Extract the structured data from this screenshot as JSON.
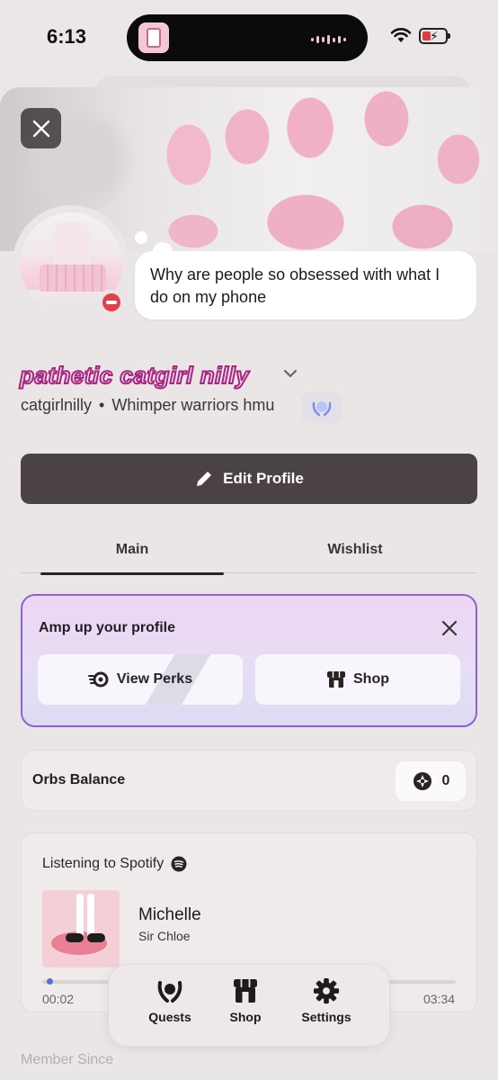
{
  "status_bar": {
    "time": "6:13"
  },
  "profile": {
    "custom_status": "Why are people so obsessed with what I do on my phone",
    "display_name": "pathetic catgirl nilly",
    "username": "catgirlnilly",
    "separator": "•",
    "pronouns": "Whimper warriors hmu",
    "status": "do-not-disturb"
  },
  "actions": {
    "edit_profile": "Edit Profile"
  },
  "tabs": [
    {
      "label": "Main",
      "active": true
    },
    {
      "label": "Wishlist",
      "active": false
    }
  ],
  "amp_card": {
    "title": "Amp up your profile",
    "view_perks": "View Perks",
    "shop": "Shop"
  },
  "orbs": {
    "label": "Orbs Balance",
    "value": "0"
  },
  "spotify": {
    "heading": "Listening to Spotify",
    "track": "Michelle",
    "artist": "Sir Chloe",
    "elapsed": "00:02",
    "duration": "03:34",
    "progress": 0.01
  },
  "member_since": "Member Since",
  "dock": [
    {
      "label": "Quests",
      "icon": "laurel-icon"
    },
    {
      "label": "Shop",
      "icon": "shop-icon"
    },
    {
      "label": "Settings",
      "icon": "gear-icon"
    }
  ],
  "colors": {
    "accent": "#8d62d8",
    "edit_button": "#4a4244",
    "dnd": "#e0424b"
  }
}
